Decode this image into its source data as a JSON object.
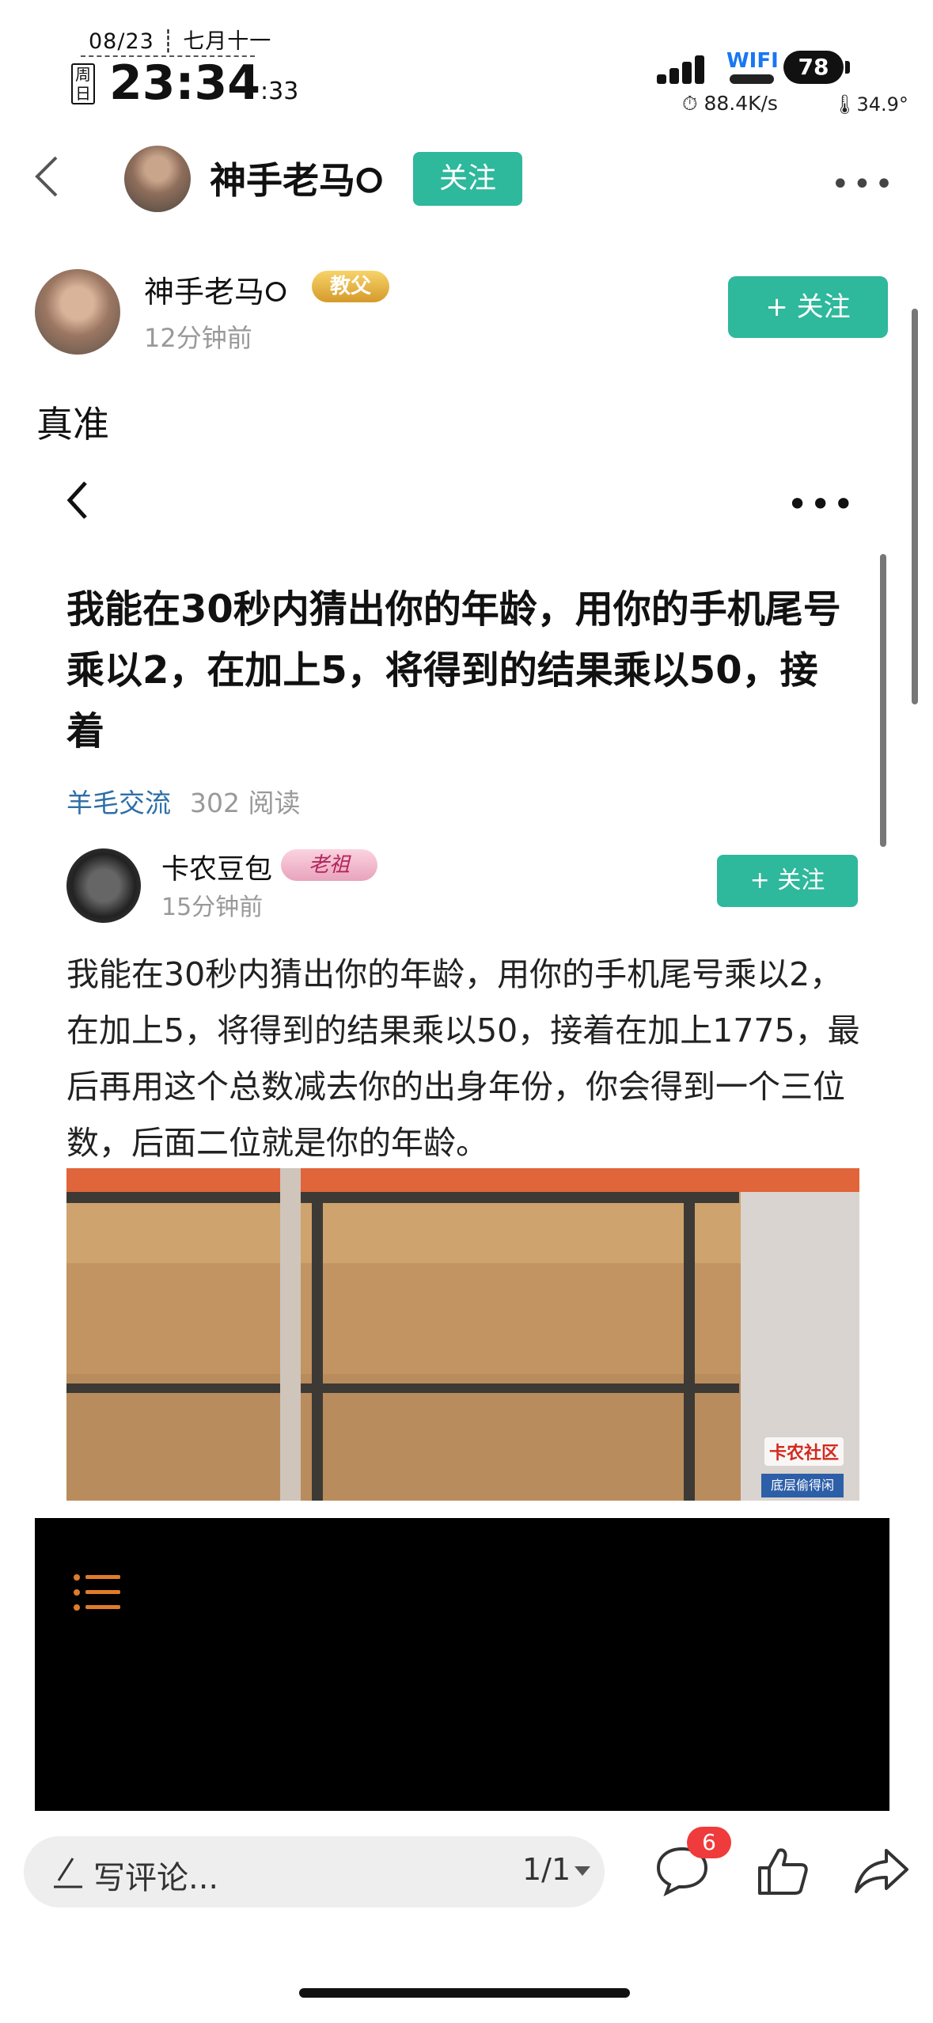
{
  "status_bar": {
    "date": "08/23 ┊ 七月十一",
    "weekday": "周日",
    "time": "23:34",
    "seconds": ":33",
    "wifi_label": "WIFI",
    "battery": "78",
    "net_speed": "88.4K/s",
    "temperature": "34.9°"
  },
  "nav": {
    "title": "神手老马𐰗",
    "follow_label": "关注",
    "more": "•••"
  },
  "post": {
    "author": "神手老马𐰗",
    "badge": "教父",
    "time": "12分钟前",
    "follow_label": "+ 关注",
    "text": "真准"
  },
  "embedded": {
    "title": "我能在30秒内猜出你的年龄，用你的手机尾号乘以2，在加上5，将得到的结果乘以50，接着",
    "topic": "羊毛交流",
    "reads": "302 阅读",
    "author": "卡农豆包",
    "badge": "老祖",
    "time": "15分钟前",
    "follow_label": "+ 关注",
    "body": "我能在30秒内猜出你的年龄，用你的手机尾号乘以2，在加上5，将得到的结果乘以50，接着在加上1775，最后再用这个总数减去你的出身年份，你会得到一个三位数，后面二位就是你的年龄。",
    "watermark": "卡农社区",
    "watermark_sub": "底层偷得闲"
  },
  "bottom_bar": {
    "comment_placeholder": "写评论...",
    "page_indicator": "1/1",
    "comment_count": "6"
  },
  "colors": {
    "accent": "#2eb89c",
    "badge_red": "#ef3b3b",
    "topic_blue": "#2d6ea7"
  }
}
